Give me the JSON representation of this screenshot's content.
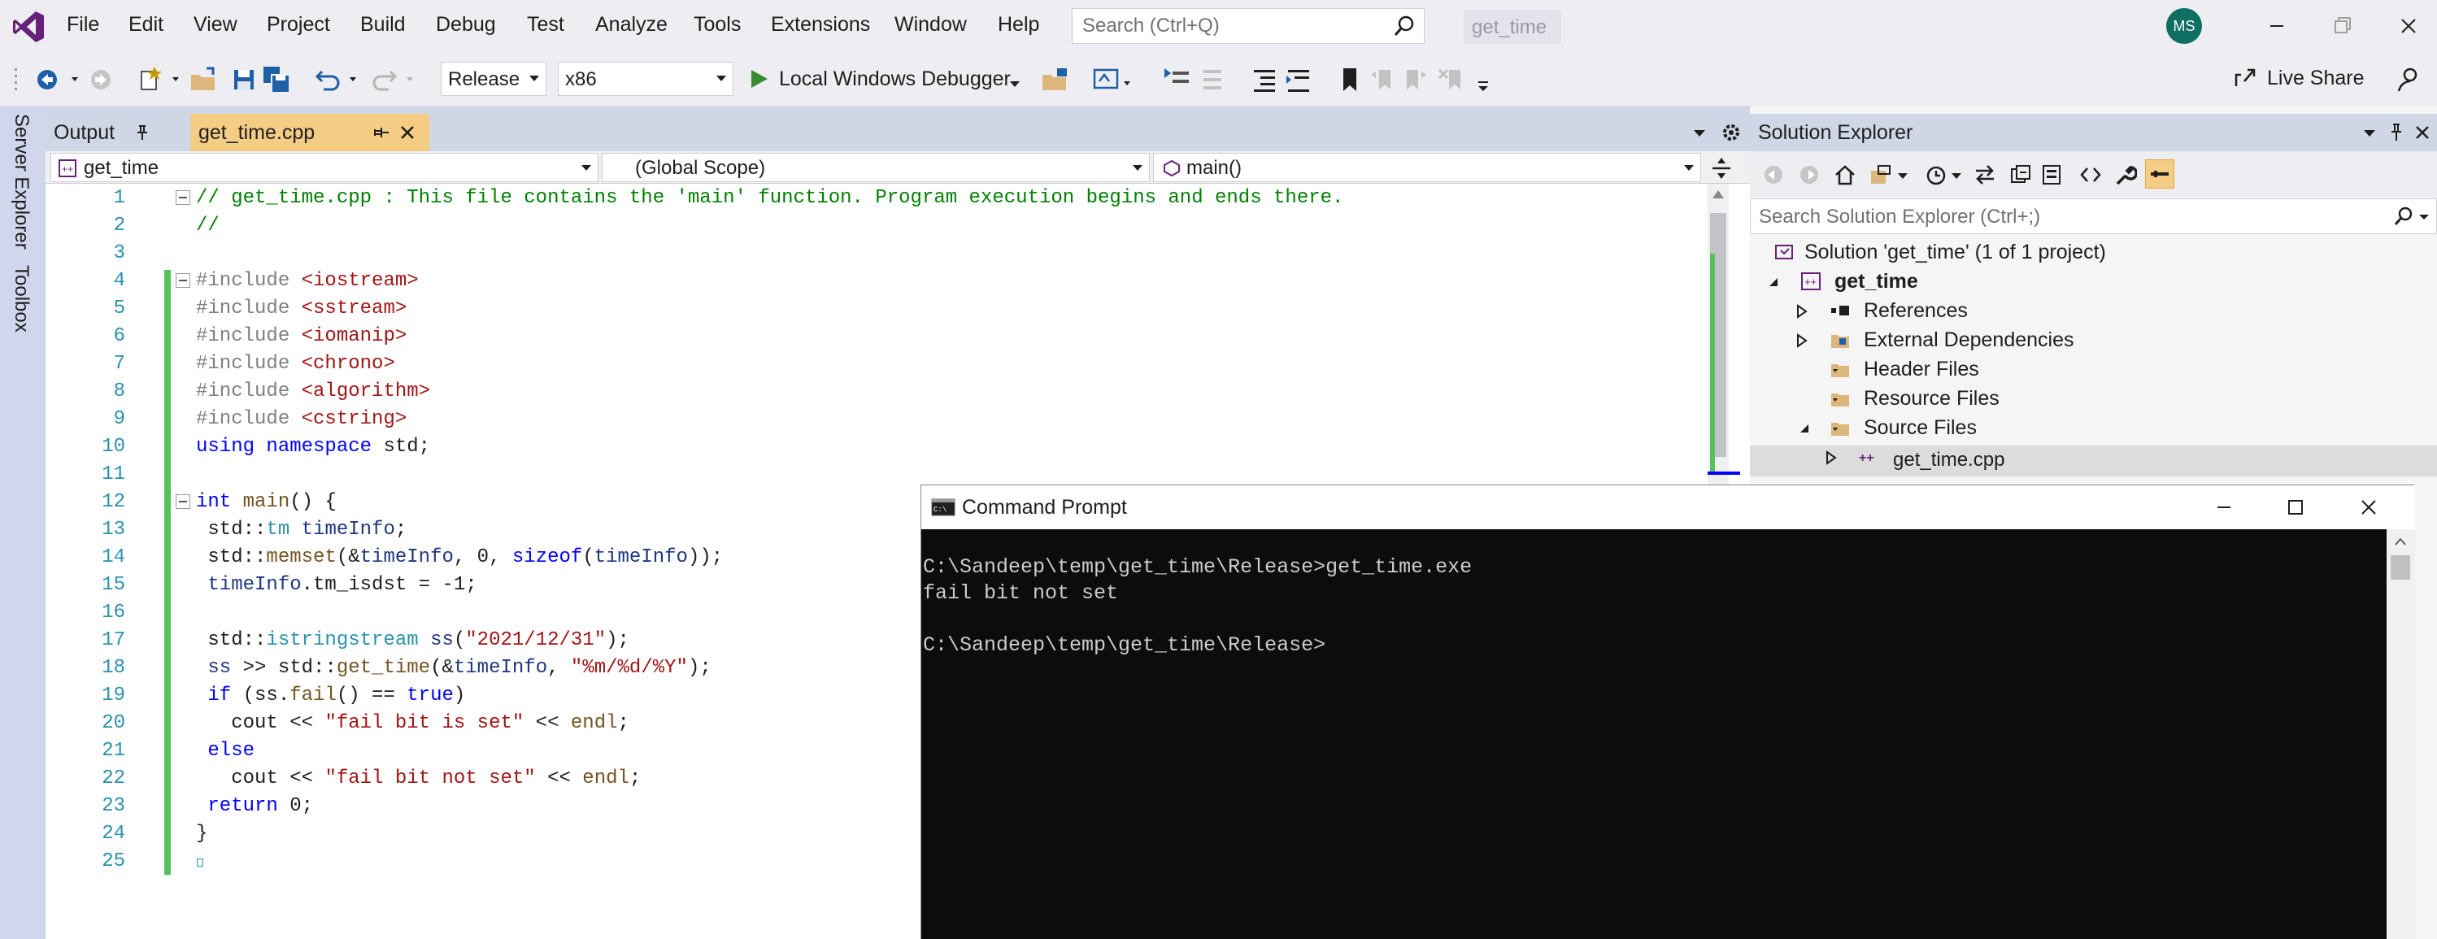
{
  "menu": {
    "items": [
      "File",
      "Edit",
      "View",
      "Project",
      "Build",
      "Debug",
      "Test",
      "Analyze",
      "Tools",
      "Extensions",
      "Window",
      "Help"
    ],
    "search_placeholder": "Search (Ctrl+Q)",
    "solution_name": "get_time",
    "avatar_initials": "MS"
  },
  "toolbar": {
    "configuration": "Release",
    "platform": "x86",
    "debugger": "Local Windows Debugger",
    "live_share": "Live Share"
  },
  "left_rail": {
    "server_explorer": "Server Explorer",
    "toolbox": "Toolbox"
  },
  "tabs": {
    "output": "Output",
    "active_file": "get_time.cpp"
  },
  "navbar": {
    "project": "get_time",
    "scope": "(Global Scope)",
    "member": "main()"
  },
  "code": {
    "line_numbers": [
      "1",
      "2",
      "3",
      "4",
      "5",
      "6",
      "7",
      "8",
      "9",
      "10",
      "11",
      "12",
      "13",
      "14",
      "15",
      "16",
      "17",
      "18",
      "19",
      "20",
      "21",
      "22",
      "23",
      "24",
      "25"
    ],
    "l1": "// get_time.cpp : This file contains the 'main' function. Program execution begins and ends there.",
    "l2": "//",
    "inc_kw": "#include",
    "inc1": "<iostream>",
    "inc2": "<sstream>",
    "inc3": "<iomanip>",
    "inc4": "<chrono>",
    "inc5": "<algorithm>",
    "inc6": "<cstring>",
    "l10_using": "using",
    "l10_namespace": "namespace",
    "l10_rest": "std;",
    "l12_int": "int",
    "l12_main": "main",
    "l12_rest": "() {",
    "l13_std": "std::",
    "l13_tm": "tm",
    "l13_var": "timeInfo",
    "l13_end": ";",
    "l14_std": "std::",
    "l14_fn": "memset",
    "l14_a": "(&",
    "l14_var": "timeInfo",
    "l14_b": ", 0, ",
    "l14_kw": "sizeof",
    "l14_c": "(",
    "l14_var2": "timeInfo",
    "l14_d": "));",
    "l15_var": "timeInfo",
    "l15_rest": ".tm_isdst = -1;",
    "l17_std": "std::",
    "l17_ty": "istringstream",
    "l17_var": "ss",
    "l17_a": "(",
    "l17_str": "\"2021/12/31\"",
    "l17_b": ");",
    "l18_var": "ss",
    "l18_a": " >> std::",
    "l18_fn": "get_time",
    "l18_b": "(&",
    "l18_var2": "timeInfo",
    "l18_c": ", ",
    "l18_str": "\"%m/%d/%Y\"",
    "l18_d": ");",
    "l19_if": "if",
    "l19_a": " (ss.",
    "l19_fn": "fail",
    "l19_b": "() == ",
    "l19_true": "true",
    "l19_c": ")",
    "l20_a": "cout << ",
    "l20_str": "\"fail bit is set\"",
    "l20_b": " << ",
    "l20_endl": "endl",
    "l20_c": ";",
    "l21_else": "else",
    "l22_a": "cout << ",
    "l22_str": "\"fail bit not set\"",
    "l22_b": " << ",
    "l22_endl": "endl",
    "l22_c": ";",
    "l23_kw": "return",
    "l23_rest": " 0;",
    "l24": "}"
  },
  "solution_explorer": {
    "title": "Solution Explorer",
    "search_placeholder": "Search Solution Explorer (Ctrl+;)",
    "solution": "Solution 'get_time' (1 of 1 project)",
    "project": "get_time",
    "references": "References",
    "external_deps": "External Dependencies",
    "header_files": "Header Files",
    "resource_files": "Resource Files",
    "source_files": "Source Files",
    "source_file": "get_time.cpp"
  },
  "cmd": {
    "title": "Command Prompt",
    "line1": "C:\\Sandeep\\temp\\get_time\\Release>get_time.exe",
    "line2": "fail bit not set",
    "line3": "",
    "line4": "C:\\Sandeep\\temp\\get_time\\Release>"
  },
  "colors": {
    "accent_purple": "#68217a",
    "active_tab": "#f5cc84",
    "change_bar": "#57c25b",
    "console_bg": "#0c0c0c"
  }
}
